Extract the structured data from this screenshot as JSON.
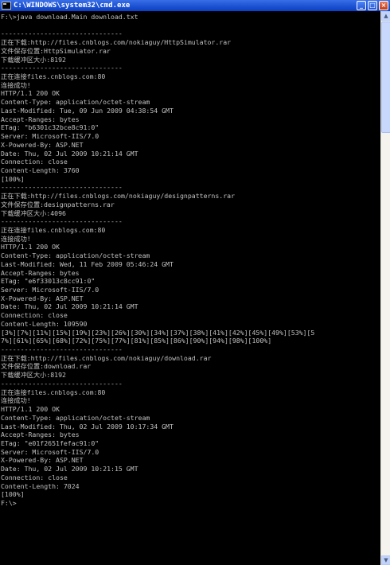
{
  "window": {
    "title": "C:\\WINDOWS\\system32\\cmd.exe",
    "minimize_glyph": "_",
    "maximize_glyph": "□",
    "close_glyph": "×"
  },
  "scrollbar": {
    "up_glyph": "▲",
    "down_glyph": "▼"
  },
  "console": {
    "lines": [
      "F:\\>java download.Main download.txt",
      "",
      "-------------------------------",
      "正在下载:http://files.cnblogs.com/nokiaguy/HttpSimulator.rar",
      "文件保存位置:HttpSimulator.rar",
      "下载缓冲区大小:8192",
      "-------------------------------",
      "正在连接files.cnblogs.com:80",
      "连接成功!",
      "HTTP/1.1 200 OK",
      "Content-Type: application/octet-stream",
      "Last-Modified: Tue, 09 Jun 2009 04:38:54 GMT",
      "Accept-Ranges: bytes",
      "ETag: \"b6301c32bce8c91:0\"",
      "Server: Microsoft-IIS/7.0",
      "X-Powered-By: ASP.NET",
      "Date: Thu, 02 Jul 2009 10:21:14 GMT",
      "Connection: close",
      "Content-Length: 3760",
      "[100%]",
      "-------------------------------",
      "正在下载:http://files.cnblogs.com/nokiaguy/designpatterns.rar",
      "文件保存位置:designpatterns.rar",
      "下载缓冲区大小:4096",
      "-------------------------------",
      "正在连接files.cnblogs.com:80",
      "连接成功!",
      "HTTP/1.1 200 OK",
      "Content-Type: application/octet-stream",
      "Last-Modified: Wed, 11 Feb 2009 05:46:24 GMT",
      "Accept-Ranges: bytes",
      "ETag: \"e6f33013c8cc91:0\"",
      "Server: Microsoft-IIS/7.0",
      "X-Powered-By: ASP.NET",
      "Date: Thu, 02 Jul 2009 10:21:14 GMT",
      "Connection: close",
      "Content-Length: 109590",
      "[3%][7%][11%][15%][19%][23%][26%][30%][34%][37%][38%][41%][42%][45%][49%][53%][5",
      "7%][61%][65%][68%][72%][75%][77%][81%][85%][86%][90%][94%][98%][100%]",
      "-------------------------------",
      "正在下载:http://files.cnblogs.com/nokiaguy/download.rar",
      "文件保存位置:download.rar",
      "下载缓冲区大小:8192",
      "-------------------------------",
      "正在连接files.cnblogs.com:80",
      "连接成功!",
      "HTTP/1.1 200 OK",
      "Content-Type: application/octet-stream",
      "Last-Modified: Thu, 02 Jul 2009 10:17:34 GMT",
      "Accept-Ranges: bytes",
      "ETag: \"e01f2651fefac91:0\"",
      "Server: Microsoft-IIS/7.0",
      "X-Powered-By: ASP.NET",
      "Date: Thu, 02 Jul 2009 10:21:15 GMT",
      "Connection: close",
      "Content-Length: 7024",
      "[100%]",
      "F:\\>"
    ]
  }
}
